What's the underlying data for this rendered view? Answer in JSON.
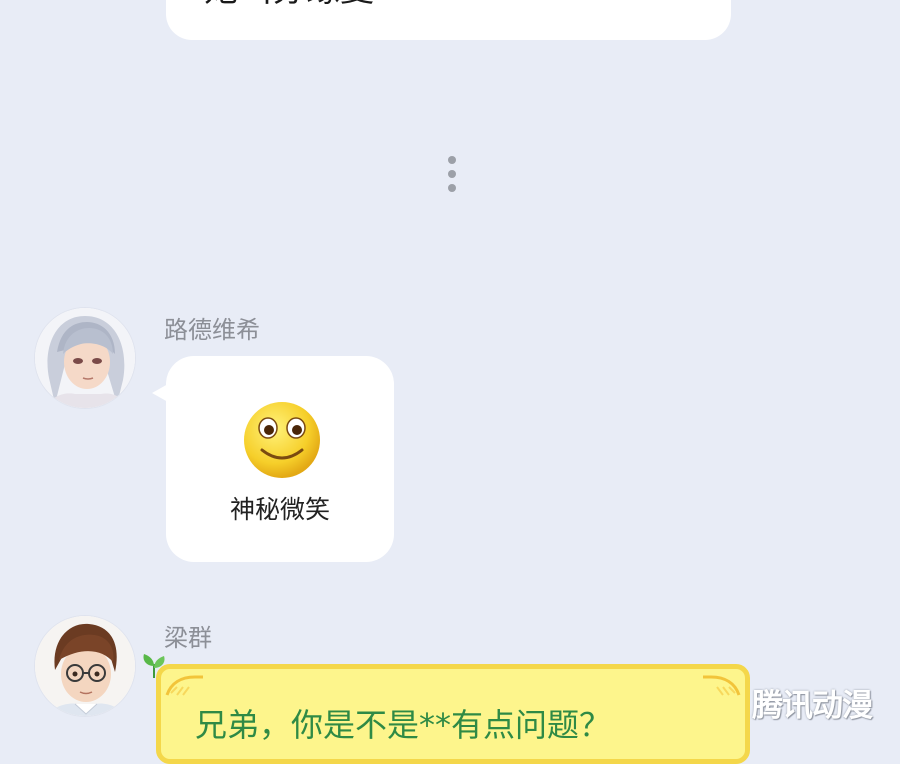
{
  "top_message": {
    "text": "她叫苏缘夏"
  },
  "separator": {
    "icon": "vertical-ellipsis-icon"
  },
  "message_1": {
    "sender": "路德维希",
    "sticker": {
      "icon": "smiley-face-icon",
      "caption": "神秘微笑"
    }
  },
  "message_2": {
    "sender": "梁群",
    "text": "兄弟，你是不是**有点问题？"
  },
  "watermark": {
    "text": "腾讯动漫"
  },
  "colors": {
    "background": "#e8ecf6",
    "bubble_white": "#ffffff",
    "bubble_yellow": "#fdf58c",
    "bubble_yellow_border": "#f4d74a",
    "yellow_text": "#2f8a45",
    "sender_name": "#8c8f97"
  }
}
